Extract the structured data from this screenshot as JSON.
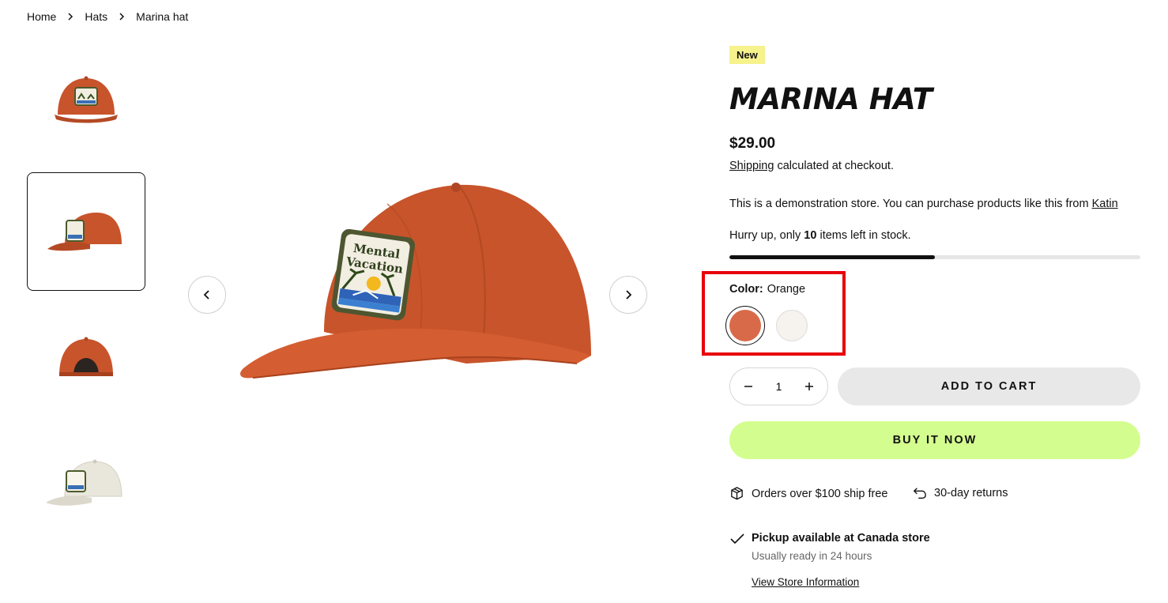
{
  "breadcrumb": {
    "items": [
      "Home",
      "Hats",
      "Marina hat"
    ]
  },
  "gallery": {
    "thumbnails": [
      {
        "view": "front",
        "color": "#c8542b"
      },
      {
        "view": "side",
        "color": "#c8542b"
      },
      {
        "view": "back",
        "color": "#c8542b"
      },
      {
        "view": "front",
        "color": "#e9e6dc"
      }
    ],
    "active_thumbnail": 1,
    "main_image": {
      "color": "#c8542b",
      "patch_text": [
        "Mental",
        "Vacation"
      ]
    },
    "prev_icon": "chevron-left-icon",
    "next_icon": "chevron-right-icon"
  },
  "product": {
    "badge": "New",
    "title": "MARINA HAT",
    "price": "$29.00",
    "shipping_link": "Shipping",
    "shipping_text": " calculated at checkout.",
    "description": "This is a demonstration store. You can purchase products like this from ",
    "description_link": "Katin",
    "stock_prefix": "Hurry up, only ",
    "stock_count": "10",
    "stock_suffix": " items left in stock.",
    "stock_level": 0.5
  },
  "variant": {
    "label": "Color:",
    "value": "Orange",
    "swatches": [
      {
        "name": "Orange",
        "color": "#d86a4a",
        "selected": true
      },
      {
        "name": "Natural",
        "color": "#f6f3ee",
        "selected": false
      }
    ],
    "highlight_color": "#e8000b"
  },
  "purchase": {
    "quantity": "1",
    "minus_icon": "minus-icon",
    "plus_icon": "plus-icon",
    "add_to_cart": "ADD TO CART",
    "buy_now": "BUY IT NOW",
    "buy_now_color": "#d4fd8f"
  },
  "perks": [
    {
      "icon": "box-icon",
      "text": "Orders over $100 ship free"
    },
    {
      "icon": "return-icon",
      "text": "30-day returns"
    }
  ],
  "pickup": {
    "title": "Pickup available at Canada store",
    "subtitle": "Usually ready in 24 hours",
    "link": "View Store Information"
  }
}
